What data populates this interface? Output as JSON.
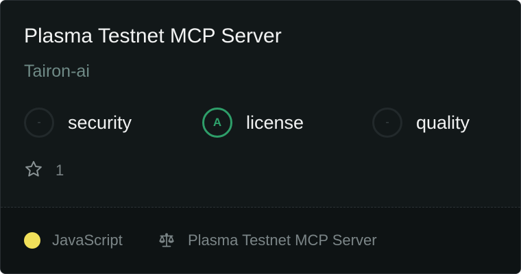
{
  "card": {
    "title": "Plasma Testnet MCP Server",
    "author": "Tairon-ai",
    "scores": [
      {
        "badge": "-",
        "label": "security",
        "graded": false
      },
      {
        "badge": "A",
        "label": "license",
        "graded": true
      },
      {
        "badge": "-",
        "label": "quality",
        "graded": false
      }
    ],
    "stars": {
      "icon": "star-outline-icon",
      "count": "1"
    },
    "footer": {
      "language": {
        "label": "JavaScript",
        "color": "#f1e05a"
      },
      "license": {
        "icon": "scale-icon",
        "label": "Plasma Testnet MCP Server"
      }
    }
  },
  "colors": {
    "background": "#121819",
    "footer_background": "#0e1314",
    "grade_green": "#2ea36c",
    "author_color": "#6f8a86"
  }
}
